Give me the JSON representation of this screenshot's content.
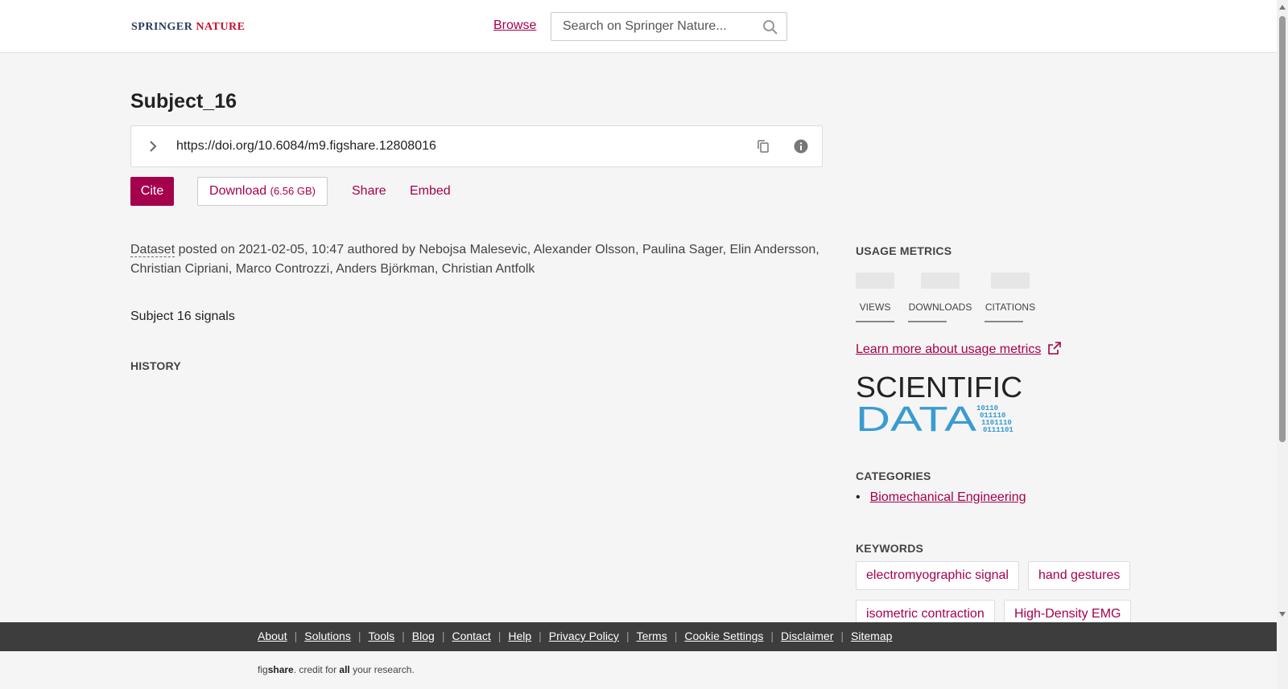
{
  "header": {
    "brand": "SPRINGER",
    "brand_accent": "NATURE",
    "browse_label": "Browse",
    "search_placeholder": "Search on Springer Nature..."
  },
  "item": {
    "title": "Subject_16",
    "doi_url": "https://doi.org/10.6084/m9.figshare.12808016",
    "actions": {
      "cite": "Cite",
      "download": "Download",
      "download_size": "(6.56 GB)",
      "share": "Share",
      "embed": "Embed"
    },
    "item_type": "Dataset",
    "posted_text": "posted on 2021-02-05, 10:47 authored by Nebojsa Malesevic, Alexander Olsson, Paulina Sager, Elin Andersson, Christian Cipriani, Marco Controzzi, Anders Björkman, Christian Antfolk",
    "description": "Subject 16 signals",
    "history_heading": "HISTORY"
  },
  "sidebar": {
    "usage_heading": "USAGE METRICS",
    "metrics": [
      "VIEWS",
      "DOWNLOADS",
      "CITATIONS"
    ],
    "learn_more": "Learn more about usage metrics",
    "logo": {
      "line1": "SCIENTIFIC",
      "line2": "DATA",
      "bits": [
        "10110",
        "011110",
        "1101110",
        "0111101"
      ]
    },
    "categories_heading": "CATEGORIES",
    "categories": [
      "Biomechanical Engineering"
    ],
    "keywords_heading": "KEYWORDS",
    "keywords": [
      "electromyographic signal",
      "hand gestures",
      "isometric contraction",
      "High-Density EMG"
    ]
  },
  "footer": {
    "links": [
      "About",
      "Solutions",
      "Tools",
      "Blog",
      "Contact",
      "Help",
      "Privacy Policy",
      "Terms",
      "Cookie Settings",
      "Disclaimer",
      "Sitemap"
    ],
    "tagline_pre": "fig",
    "tagline_brand": "share",
    "tagline_mid": ". credit for ",
    "tagline_bold": "all",
    "tagline_post": " your research."
  },
  "colors": {
    "accent": "#a5004d",
    "footer_bg": "#3d3d3d",
    "logo_blue": "#3a9bd1"
  }
}
